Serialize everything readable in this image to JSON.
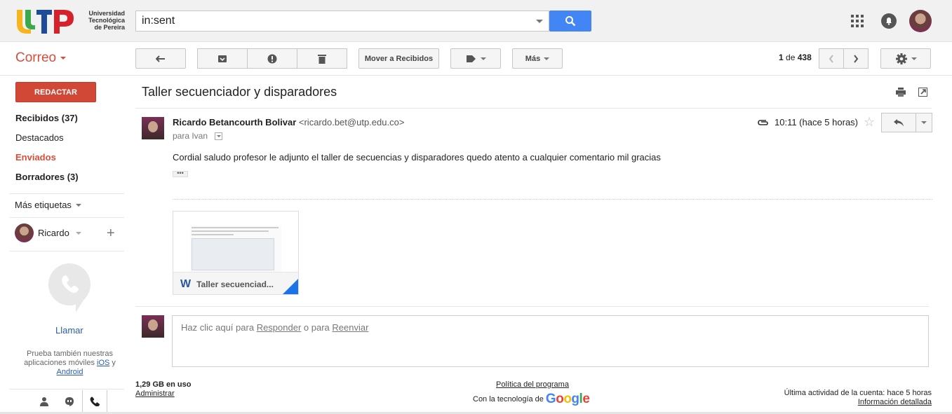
{
  "header": {
    "logo_text": "Universidad Tecnológica de Pereira",
    "search_value": "in:sent"
  },
  "toolbar": {
    "app_label": "Correo",
    "move_inbox_label": "Mover a Recibidos",
    "more_label": "Más",
    "pager_range": "1",
    "pager_of": "de",
    "pager_total": "438"
  },
  "sidebar": {
    "compose_label": "REDACTAR",
    "items": [
      {
        "label": "Recibidos (37)"
      },
      {
        "label": "Destacados"
      },
      {
        "label": "Enviados"
      },
      {
        "label": "Borradores (3)"
      }
    ],
    "more_labels": "Más etiquetas",
    "hangouts_user": "Ricardo",
    "call_label": "Llamar",
    "try_text": "Prueba también nuestras aplicaciones móviles",
    "ios_link": "iOS",
    "and_text": "y",
    "android_link": "Android"
  },
  "message": {
    "subject": "Taller secuenciador y disparadores",
    "sender_name": "Ricardo Betancourth Bolivar",
    "sender_email": "<ricardo.bet@utp.edu.co>",
    "recipient": "para Ivan",
    "time": "10:11 (hace 5 horas)",
    "body": "Cordial saludo profesor le adjunto el taller de secuencias y disparadores quedo atento a cualquier comentario mil gracias",
    "ellipsis": "•••",
    "attachment_name": "Taller secuenciad...",
    "attachment_icon": "W"
  },
  "reply": {
    "prefix": "Haz clic aquí para",
    "reply_link": "Responder",
    "middle": "o para",
    "forward_link": "Reenviar"
  },
  "footer": {
    "usage": "1,29 GB en uso",
    "manage": "Administrar",
    "policy": "Política del programa",
    "powered_by": "Con la tecnología de",
    "google": "Google",
    "last_activity": "Última actividad de la cuenta: hace 5 horas",
    "details": "Información detallada"
  },
  "colors": {
    "accent_red": "#dd4b39",
    "compose_red": "#d14836",
    "search_blue": "#4285f4",
    "link_blue": "#2a5db0"
  }
}
